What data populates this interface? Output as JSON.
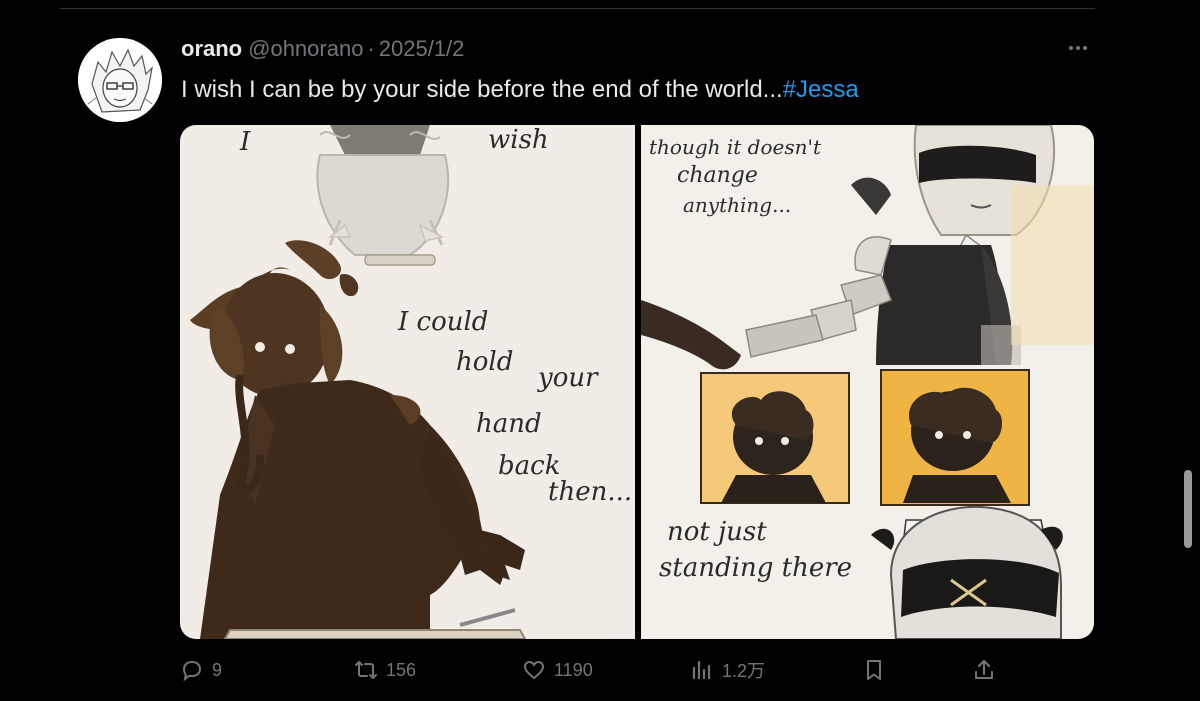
{
  "tweet": {
    "author": {
      "name": "orano",
      "handle": "@ohnorano",
      "separator": "·",
      "date": "2025/1/2"
    },
    "text": "I wish I can be by your side before the end of the world...",
    "hashtag": "#Jessa",
    "media": {
      "left_panel": {
        "lines": [
          "I",
          "wish",
          "I could",
          "hold",
          "your",
          "hand",
          "back",
          "then..."
        ]
      },
      "right_panel": {
        "lines": [
          "though it doesn't",
          "change",
          "anything...",
          "not just",
          "standing there"
        ]
      }
    },
    "actions": {
      "replies": "9",
      "retweets": "156",
      "likes": "1190",
      "views": "1.2万"
    }
  },
  "colors": {
    "background": "#000000",
    "text": "#e7e9ea",
    "muted": "#71767b",
    "link": "#1d9bf0"
  },
  "icons": [
    "reply-icon",
    "retweet-icon",
    "like-icon",
    "views-icon",
    "bookmark-icon",
    "share-icon",
    "more-icon"
  ]
}
